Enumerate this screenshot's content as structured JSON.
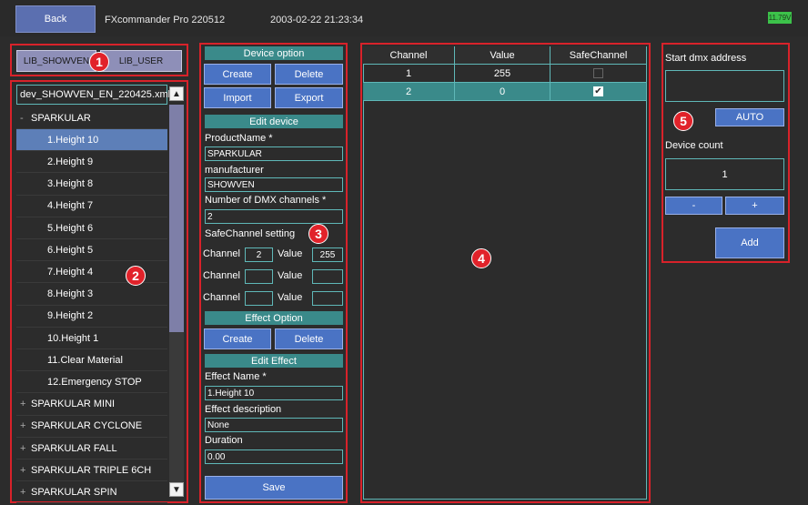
{
  "topbar": {
    "back_label": "Back",
    "app_title": "FXcommander Pro 220512",
    "datetime": "2003-02-22 21:23:34",
    "battery": "11.79V"
  },
  "markers": [
    "1",
    "2",
    "3",
    "4",
    "5"
  ],
  "lib_tabs": [
    "LIB_SHOWVEN",
    "LIB_USER"
  ],
  "tree": {
    "file": "dev_SHOWVEN_EN_220425.xml",
    "rows": [
      {
        "label": "SPARKULAR",
        "level": 0,
        "prefix": "-"
      },
      {
        "label": "1.Height 10",
        "level": 1,
        "prefix": ""
      },
      {
        "label": "2.Height 9",
        "level": 1,
        "prefix": ""
      },
      {
        "label": "3.Height 8",
        "level": 1,
        "prefix": ""
      },
      {
        "label": "4.Height 7",
        "level": 1,
        "prefix": ""
      },
      {
        "label": "5.Height 6",
        "level": 1,
        "prefix": ""
      },
      {
        "label": "6.Height 5",
        "level": 1,
        "prefix": ""
      },
      {
        "label": "7.Height 4",
        "level": 1,
        "prefix": ""
      },
      {
        "label": "8.Height 3",
        "level": 1,
        "prefix": ""
      },
      {
        "label": "9.Height 2",
        "level": 1,
        "prefix": ""
      },
      {
        "label": "10.Height 1",
        "level": 1,
        "prefix": ""
      },
      {
        "label": "11.Clear Material",
        "level": 1,
        "prefix": ""
      },
      {
        "label": "12.Emergency STOP",
        "level": 1,
        "prefix": ""
      },
      {
        "label": "SPARKULAR MINI",
        "level": 0,
        "prefix": "+"
      },
      {
        "label": "SPARKULAR CYCLONE",
        "level": 0,
        "prefix": "+"
      },
      {
        "label": "SPARKULAR FALL",
        "level": 0,
        "prefix": "+"
      },
      {
        "label": "SPARKULAR TRIPLE 6CH",
        "level": 0,
        "prefix": "+"
      },
      {
        "label": "SPARKULAR SPIN",
        "level": 0,
        "prefix": "+"
      }
    ],
    "selected_index": 1
  },
  "device": {
    "header": "Device option",
    "create": "Create",
    "delete": "Delete",
    "import": "Import",
    "export": "Export",
    "edit_header": "Edit device",
    "product_label": "ProductName *",
    "product_value": "SPARKULAR",
    "manufacturer_label": "manufacturer",
    "manufacturer_value": "SHOWVEN",
    "dmx_label": "Number of DMX channels *",
    "dmx_value": "2",
    "safe_label": "SafeChannel setting",
    "channel_label": "Channel",
    "value_label": "Value",
    "safe_rows": [
      {
        "channel": "2",
        "value": "255"
      },
      {
        "channel": "",
        "value": ""
      },
      {
        "channel": "",
        "value": ""
      }
    ]
  },
  "effect": {
    "header": "Effect Option",
    "create": "Create",
    "delete": "Delete",
    "edit_header": "Edit Effect",
    "name_label": "Effect Name *",
    "name_value": "1.Height 10",
    "desc_label": "Effect description",
    "desc_value": "None",
    "duration_label": "Duration",
    "duration_value": "0.00",
    "save": "Save"
  },
  "table": {
    "headers": [
      "Channel",
      "Value",
      "SafeChannel"
    ],
    "rows": [
      {
        "channel": "1",
        "value": "255",
        "safe": false
      },
      {
        "channel": "2",
        "value": "0",
        "safe": true
      }
    ],
    "selected_row": 1
  },
  "right": {
    "start_label": "Start dmx address",
    "start_value": "",
    "auto": "AUTO",
    "count_label": "Device count",
    "count_value": "1",
    "minus": "-",
    "plus": "+",
    "add": "Add"
  }
}
